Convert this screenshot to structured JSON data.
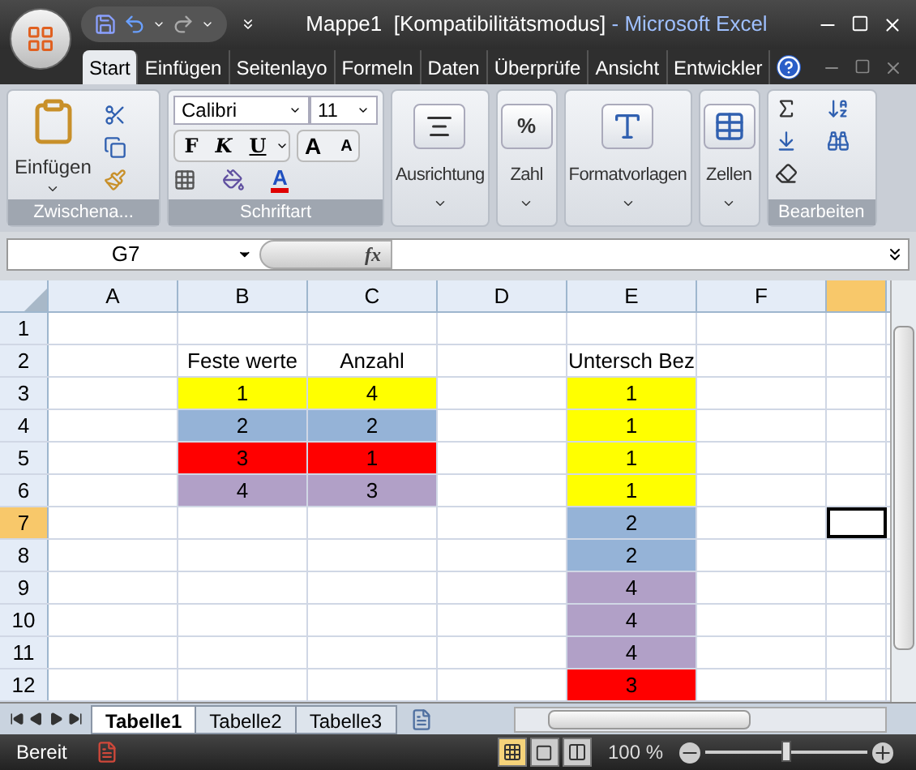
{
  "window": {
    "title": "Mappe1  [Kompatibilitätsmodus]",
    "app": " - Microsoft Excel"
  },
  "tabs": [
    {
      "label": "Start",
      "selected": true
    },
    {
      "label": "Einfügen",
      "selected": false
    },
    {
      "label": "Seitenlayo",
      "selected": false
    },
    {
      "label": "Formeln",
      "selected": false
    },
    {
      "label": "Daten",
      "selected": false
    },
    {
      "label": "Überprüfe",
      "selected": false
    },
    {
      "label": "Ansicht",
      "selected": false
    },
    {
      "label": "Entwickler",
      "selected": false
    }
  ],
  "ribbon": {
    "clipboard": {
      "label": "Zwischena...",
      "paste": "Einfügen"
    },
    "font": {
      "label": "Schriftart",
      "family": "Calibri",
      "size": "11",
      "bold": "F",
      "italic": "K",
      "underline": "U",
      "grow": "A",
      "shrink": "A",
      "font_color_glyph": "A"
    },
    "groups": [
      {
        "kind": "align",
        "label": "Ausrichtung"
      },
      {
        "kind": "number",
        "label": "Zahl",
        "glyph": "%"
      },
      {
        "kind": "styles",
        "label": "Formatvorlagen"
      },
      {
        "kind": "cells",
        "label": "Zellen"
      }
    ],
    "editing": {
      "label": "Bearbeiten"
    }
  },
  "name_box": "G7",
  "formula_label": "fx",
  "columns": [
    {
      "label": "A",
      "selected": false
    },
    {
      "label": "B",
      "selected": false
    },
    {
      "label": "C",
      "selected": false
    },
    {
      "label": "D",
      "selected": false
    },
    {
      "label": "E",
      "selected": false
    },
    {
      "label": "F",
      "selected": false
    },
    {
      "selected": true
    }
  ],
  "rows": [
    {
      "label": "1",
      "selected": false,
      "cells": {}
    },
    {
      "label": "2",
      "selected": false,
      "cells": {
        "B": {
          "text": "Feste werte"
        },
        "C": {
          "text": "Anzahl"
        },
        "E": {
          "text": "Untersch Bez"
        }
      }
    },
    {
      "label": "3",
      "selected": false,
      "cells": {
        "B": {
          "text": "1",
          "color": "#ffff00"
        },
        "C": {
          "text": "4",
          "color": "#ffff00"
        },
        "E": {
          "text": "1",
          "color": "#ffff00"
        }
      }
    },
    {
      "label": "4",
      "selected": false,
      "cells": {
        "B": {
          "text": "2",
          "color": "#95b3d7"
        },
        "C": {
          "text": "2",
          "color": "#95b3d7"
        },
        "E": {
          "text": "1",
          "color": "#ffff00"
        }
      }
    },
    {
      "label": "5",
      "selected": false,
      "cells": {
        "B": {
          "text": "3",
          "color": "#ff0000"
        },
        "C": {
          "text": "1",
          "color": "#ff0000"
        },
        "E": {
          "text": "1",
          "color": "#ffff00"
        }
      }
    },
    {
      "label": "6",
      "selected": false,
      "cells": {
        "B": {
          "text": "4",
          "color": "#b1a0c7"
        },
        "C": {
          "text": "3",
          "color": "#b1a0c7"
        },
        "E": {
          "text": "1",
          "color": "#ffff00"
        }
      }
    },
    {
      "label": "7",
      "selected": true,
      "cells": {
        "E": {
          "text": "2",
          "color": "#95b3d7"
        },
        "G": {
          "active": true
        }
      }
    },
    {
      "label": "8",
      "selected": false,
      "cells": {
        "E": {
          "text": "2",
          "color": "#95b3d7"
        }
      }
    },
    {
      "label": "9",
      "selected": false,
      "cells": {
        "E": {
          "text": "4",
          "color": "#b1a0c7"
        }
      }
    },
    {
      "label": "10",
      "selected": false,
      "cells": {
        "E": {
          "text": "4",
          "color": "#b1a0c7"
        }
      }
    },
    {
      "label": "11",
      "selected": false,
      "cells": {
        "E": {
          "text": "4",
          "color": "#b1a0c7"
        }
      }
    },
    {
      "label": "12",
      "selected": false,
      "cells": {
        "E": {
          "text": "3",
          "color": "#ff0000"
        }
      }
    }
  ],
  "sheets": [
    {
      "label": "Tabelle1",
      "selected": true
    },
    {
      "label": "Tabelle2",
      "selected": false
    },
    {
      "label": "Tabelle3",
      "selected": false
    }
  ],
  "status_bar": {
    "state": "Bereit",
    "views": [
      {
        "kind": "normal",
        "selected": true
      },
      {
        "kind": "layout",
        "selected": false
      },
      {
        "kind": "pagebreak",
        "selected": false
      }
    ],
    "zoom": "100 %",
    "zoom_slider": {
      "level": 0.5
    }
  }
}
